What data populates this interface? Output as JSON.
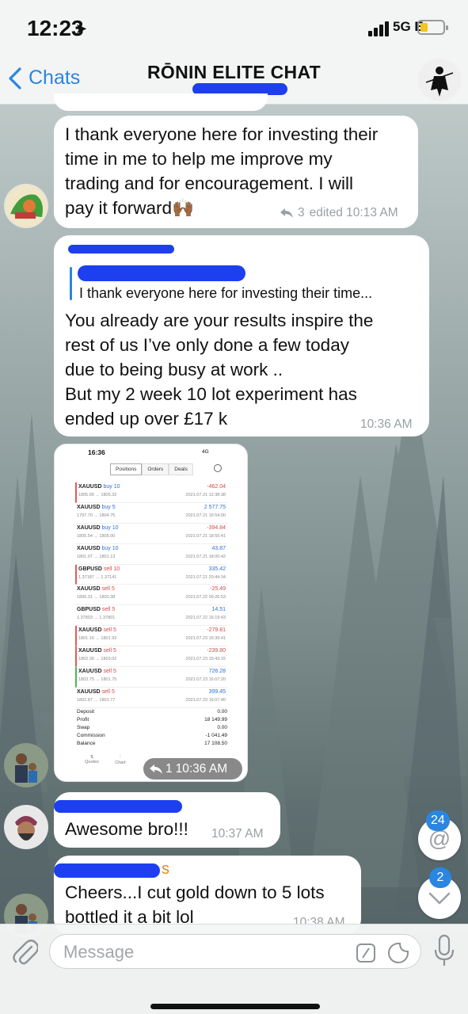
{
  "status_bar": {
    "time": "12:23",
    "network": "5G E"
  },
  "nav": {
    "back_label": "Chats",
    "title": "RŌNIN ELITE CHAT"
  },
  "messages": [
    {
      "id": "m1",
      "lines": [
        "I thank everyone here for investing their",
        "time in me to help me improve my",
        "trading and for encouragement. I will",
        "pay it forward🙌🏾"
      ],
      "replies": "3",
      "meta": "edited 10:13 AM"
    },
    {
      "id": "m2",
      "reply_preview": "I thank everyone here for investing their time...",
      "lines": [
        "You already are your results inspire the",
        "rest of us I’ve only done a few today",
        "due to being busy at work ..",
        "But my 2 week 10 lot experiment has",
        "ended up over £17 k"
      ],
      "meta": "10:36 AM"
    },
    {
      "id": "m3",
      "type": "image",
      "replies": "1",
      "meta": "10:36 AM",
      "screenshot": {
        "time": "16:36",
        "status": "4G",
        "tabs": [
          "Positions",
          "Orders",
          "Deals"
        ],
        "rows": [
          {
            "symbol": "XAUUSD",
            "side": "buy 10",
            "side_type": "buy",
            "prices": "1805.95 → 1805.32",
            "pl": "-462.04",
            "pl_type": "neg",
            "date": "2021.07.21 12:38:38",
            "mark": "red"
          },
          {
            "symbol": "XAUUSD",
            "side": "buy 5",
            "side_type": "buy",
            "prices": "1797.70 → 1804.75",
            "pl": "2 577.75",
            "pl_type": "pos",
            "date": "2021.07.21 16:54:00",
            "mark": ""
          },
          {
            "symbol": "XAUUSD",
            "side": "buy 10",
            "side_type": "buy",
            "prices": "1805.54 → 1805.00",
            "pl": "-394.84",
            "pl_type": "neg",
            "date": "2021.07.21 18:55:41",
            "mark": ""
          },
          {
            "symbol": "XAUUSD",
            "side": "buy 10",
            "side_type": "buy",
            "prices": "1801.07 → 1801.13",
            "pl": "43.87",
            "pl_type": "pos",
            "date": "2021.07.21 18:00:42",
            "mark": ""
          },
          {
            "symbol": "GBPUSD",
            "side": "sell 10",
            "side_type": "sell",
            "prices": "1.37187 → 1.37141",
            "pl": "335.42",
            "pl_type": "pos",
            "date": "2021.07.21 20:44:34",
            "mark": "red"
          },
          {
            "symbol": "XAUUSD",
            "side": "sell 5",
            "side_type": "sell",
            "prices": "1800.31 → 1800.38",
            "pl": "-25.49",
            "pl_type": "neg",
            "date": "2021.07.22 09:26:53",
            "mark": ""
          },
          {
            "symbol": "GBPUSD",
            "side": "sell 5",
            "side_type": "sell",
            "prices": "1.37803 → 1.37801",
            "pl": "14.51",
            "pl_type": "pos",
            "date": "2021.07.22 16:19:43",
            "mark": ""
          },
          {
            "symbol": "XAUUSD",
            "side": "sell 5",
            "side_type": "sell",
            "prices": "1801.16 → 1801.93",
            "pl": "-279.81",
            "pl_type": "neg",
            "date": "2021.07.23 15:39:41",
            "mark": "red"
          },
          {
            "symbol": "XAUUSD",
            "side": "sell 5",
            "side_type": "sell",
            "prices": "1802.36 → 1803.02",
            "pl": "-239.80",
            "pl_type": "neg",
            "date": "2021.07.23 15:43:15",
            "mark": "red"
          },
          {
            "symbol": "XAUUSD",
            "side": "sell 5",
            "side_type": "sell",
            "prices": "1803.75 → 1801.75",
            "pl": "726.28",
            "pl_type": "pos",
            "date": "2021.07.23 16:07:20",
            "mark": "green"
          },
          {
            "symbol": "XAUUSD",
            "side": "sell 5",
            "side_type": "sell",
            "prices": "1802.87 → 1801.77",
            "pl": "399.45",
            "pl_type": "pos",
            "date": "2021.07.23 16:07:40",
            "mark": ""
          }
        ],
        "summary": [
          {
            "label": "Deposit",
            "value": "0.00"
          },
          {
            "label": "Profit",
            "value": "18 149.99"
          },
          {
            "label": "Swap",
            "value": "0.00"
          },
          {
            "label": "Commission",
            "value": "-1 041.49"
          },
          {
            "label": "Balance",
            "value": "17 108.50"
          }
        ],
        "bottom_tabs": [
          "Quotes",
          "Chart"
        ]
      }
    },
    {
      "id": "m4",
      "lines": [
        "Awesome bro!!!"
      ],
      "meta": "10:37 AM"
    },
    {
      "id": "m5",
      "name_fragment": "s",
      "lines": [
        "Cheers...I cut gold down to 5 lots",
        "bottled it a bit lol"
      ],
      "meta": "10:38 AM"
    }
  ],
  "floating": {
    "mentions_count": "24",
    "unread_count": "2"
  },
  "input": {
    "placeholder": "Message"
  },
  "colors": {
    "accent": "#2a86e0",
    "redaction": "#1d3ff0",
    "bubble": "#ffffff"
  }
}
